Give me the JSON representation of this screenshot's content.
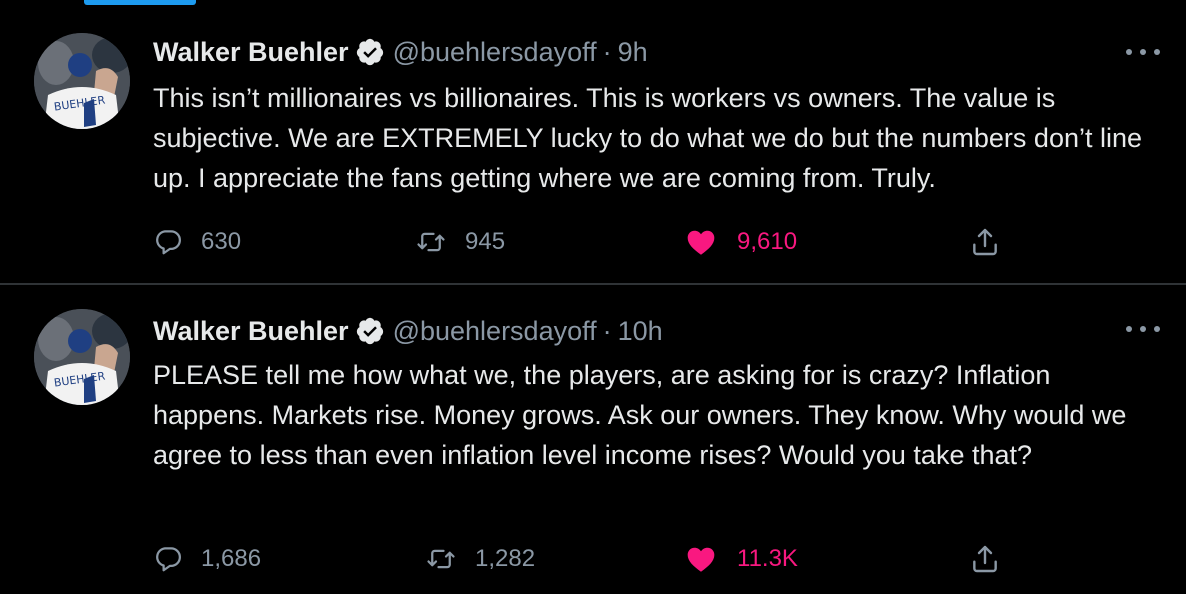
{
  "colors": {
    "background": "#000000",
    "text_primary": "#e7e9ea",
    "text_secondary": "#8b98a5",
    "like_active": "#f91880",
    "verified_badge": "#e7e9ea",
    "accent": "#1d9bf0"
  },
  "icons": {
    "reply": "speech-bubble-icon",
    "retweet": "retweet-arrows-icon",
    "like": "heart-filled-icon",
    "share": "share-upload-icon",
    "verified": "verified-badge-icon",
    "more": "more-horizontal-icon"
  },
  "tweets": [
    {
      "author_name": "Walker Buehler",
      "handle": "@buehlersdayoff",
      "separator": "·",
      "time": "9h",
      "avatar_jersey_text": "BUEHLER",
      "text": "This isn’t millionaires vs billionaires. This is workers vs owners. The value is subjective. We are EXTREMELY lucky to do what we do but the numbers don’t line up. I appreciate the fans getting where we are coming from. Truly.",
      "replies": "630",
      "retweets": "945",
      "likes": "9,610",
      "liked": true
    },
    {
      "author_name": "Walker Buehler",
      "handle": "@buehlersdayoff",
      "separator": "·",
      "time": "10h",
      "avatar_jersey_text": "BUEHLER",
      "text": "PLEASE tell me how what we, the players, are asking for is crazy? Inflation happens. Markets rise. Money grows. Ask our owners. They know. Why would we agree to less than even inflation level income rises? Would you take that?",
      "replies": "1,686",
      "retweets": "1,282",
      "likes": "11.3K",
      "liked": true
    }
  ]
}
